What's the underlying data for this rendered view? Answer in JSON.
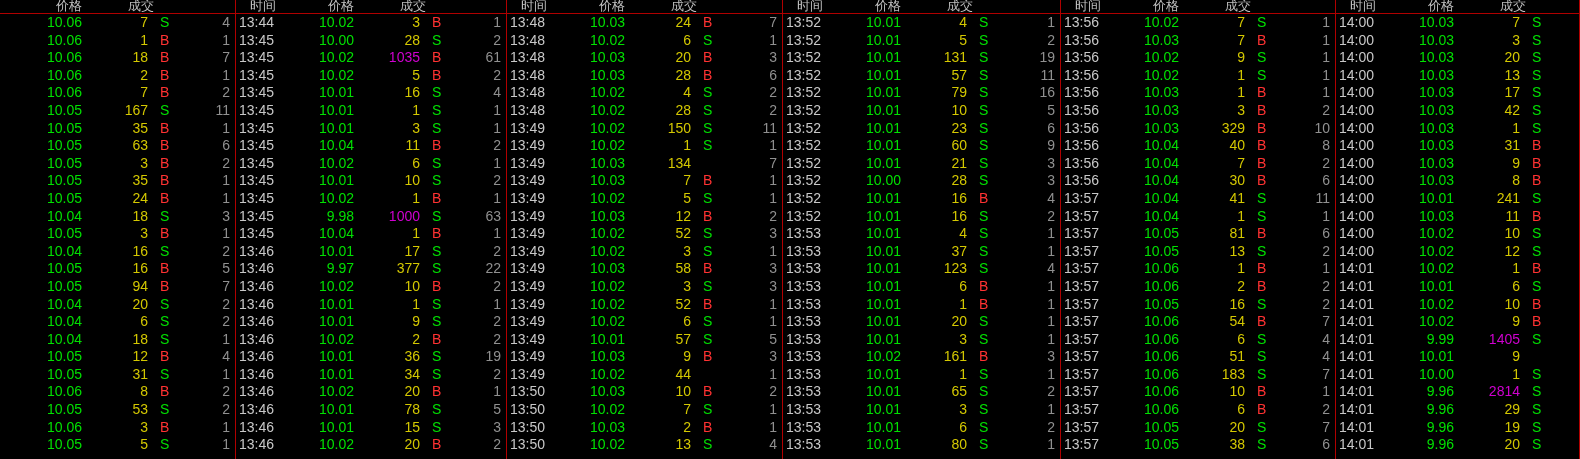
{
  "panels": [
    {
      "headers": [
        "价格",
        "成交"
      ],
      "rows": [
        {
          "price": "10.06",
          "volume": "7",
          "large": false,
          "side": "S",
          "color": "#00e000",
          "count": "4"
        },
        {
          "price": "10.06",
          "volume": "1",
          "large": false,
          "side": "B",
          "color": "#ff3232",
          "count": "1"
        },
        {
          "price": "10.06",
          "volume": "18",
          "large": false,
          "side": "B",
          "color": "#ff3232",
          "count": "7"
        },
        {
          "price": "10.06",
          "volume": "2",
          "large": false,
          "side": "B",
          "color": "#ff3232",
          "count": "1"
        },
        {
          "price": "10.06",
          "volume": "7",
          "large": false,
          "side": "B",
          "color": "#ff3232",
          "count": "2"
        },
        {
          "price": "10.05",
          "volume": "167",
          "large": false,
          "side": "S",
          "color": "#00e000",
          "count": "11"
        },
        {
          "price": "10.05",
          "volume": "35",
          "large": false,
          "side": "B",
          "color": "#ff3232",
          "count": "1"
        },
        {
          "price": "10.05",
          "volume": "63",
          "large": false,
          "side": "B",
          "color": "#ff3232",
          "count": "6"
        },
        {
          "price": "10.05",
          "volume": "3",
          "large": false,
          "side": "B",
          "color": "#ff3232",
          "count": "2"
        },
        {
          "price": "10.05",
          "volume": "35",
          "large": false,
          "side": "B",
          "color": "#ff3232",
          "count": "1"
        },
        {
          "price": "10.05",
          "volume": "24",
          "large": false,
          "side": "B",
          "color": "#ff3232",
          "count": "1"
        },
        {
          "price": "10.04",
          "volume": "18",
          "large": false,
          "side": "S",
          "color": "#00e000",
          "count": "3"
        },
        {
          "price": "10.05",
          "volume": "3",
          "large": false,
          "side": "B",
          "color": "#ff3232",
          "count": "1"
        },
        {
          "price": "10.04",
          "volume": "16",
          "large": false,
          "side": "S",
          "color": "#00e000",
          "count": "2"
        },
        {
          "price": "10.05",
          "volume": "16",
          "large": false,
          "side": "B",
          "color": "#ff3232",
          "count": "5"
        },
        {
          "price": "10.05",
          "volume": "94",
          "large": false,
          "side": "B",
          "color": "#ff3232",
          "count": "7"
        },
        {
          "price": "10.04",
          "volume": "20",
          "large": false,
          "side": "S",
          "color": "#00e000",
          "count": "2"
        },
        {
          "price": "10.04",
          "volume": "6",
          "large": false,
          "side": "S",
          "color": "#00e000",
          "count": "2"
        },
        {
          "price": "10.04",
          "volume": "18",
          "large": false,
          "side": "S",
          "color": "#00e000",
          "count": "1"
        },
        {
          "price": "10.05",
          "volume": "12",
          "large": false,
          "side": "B",
          "color": "#ff3232",
          "count": "4"
        },
        {
          "price": "10.05",
          "volume": "31",
          "large": false,
          "side": "S",
          "color": "#00e000",
          "count": "1"
        },
        {
          "price": "10.06",
          "volume": "8",
          "large": false,
          "side": "B",
          "color": "#ff3232",
          "count": "2"
        },
        {
          "price": "10.05",
          "volume": "53",
          "large": false,
          "side": "S",
          "color": "#00e000",
          "count": "2"
        },
        {
          "price": "10.06",
          "volume": "3",
          "large": false,
          "side": "B",
          "color": "#ff3232",
          "count": "1"
        },
        {
          "price": "10.05",
          "volume": "5",
          "large": false,
          "side": "S",
          "color": "#00e000",
          "count": "1"
        }
      ]
    },
    {
      "headers": [
        "时间",
        "价格",
        "成交"
      ],
      "rows": [
        {
          "time": "13:44",
          "price": "10.02",
          "volume": "3",
          "large": false,
          "side": "B",
          "color": "#ff3232",
          "count": "1"
        },
        {
          "time": "13:45",
          "price": "10.00",
          "volume": "28",
          "large": false,
          "side": "S",
          "color": "#00e000",
          "count": "2"
        },
        {
          "time": "13:45",
          "price": "10.02",
          "volume": "1035",
          "large": true,
          "side": "B",
          "color": "#ff3232",
          "count": "61"
        },
        {
          "time": "13:45",
          "price": "10.02",
          "volume": "5",
          "large": false,
          "side": "B",
          "color": "#ff3232",
          "count": "2"
        },
        {
          "time": "13:45",
          "price": "10.01",
          "volume": "16",
          "large": false,
          "side": "S",
          "color": "#00e000",
          "count": "4"
        },
        {
          "time": "13:45",
          "price": "10.01",
          "volume": "1",
          "large": false,
          "side": "S",
          "color": "#00e000",
          "count": "1"
        },
        {
          "time": "13:45",
          "price": "10.01",
          "volume": "3",
          "large": false,
          "side": "S",
          "color": "#00e000",
          "count": "1"
        },
        {
          "time": "13:45",
          "price": "10.04",
          "volume": "11",
          "large": false,
          "side": "B",
          "color": "#ff3232",
          "count": "2"
        },
        {
          "time": "13:45",
          "price": "10.02",
          "volume": "6",
          "large": false,
          "side": "S",
          "color": "#00e000",
          "count": "1"
        },
        {
          "time": "13:45",
          "price": "10.01",
          "volume": "10",
          "large": false,
          "side": "S",
          "color": "#00e000",
          "count": "2"
        },
        {
          "time": "13:45",
          "price": "10.02",
          "volume": "1",
          "large": false,
          "side": "B",
          "color": "#ff3232",
          "count": "1"
        },
        {
          "time": "13:45",
          "price": "9.98",
          "volume": "1000",
          "large": true,
          "side": "S",
          "color": "#00e000",
          "count": "63"
        },
        {
          "time": "13:45",
          "price": "10.04",
          "volume": "1",
          "large": false,
          "side": "B",
          "color": "#ff3232",
          "count": "1"
        },
        {
          "time": "13:46",
          "price": "10.01",
          "volume": "17",
          "large": false,
          "side": "S",
          "color": "#00e000",
          "count": "2"
        },
        {
          "time": "13:46",
          "price": "9.97",
          "volume": "377",
          "large": false,
          "side": "S",
          "color": "#00e000",
          "count": "22"
        },
        {
          "time": "13:46",
          "price": "10.02",
          "volume": "10",
          "large": false,
          "side": "B",
          "color": "#ff3232",
          "count": "2"
        },
        {
          "time": "13:46",
          "price": "10.01",
          "volume": "1",
          "large": false,
          "side": "S",
          "color": "#00e000",
          "count": "1"
        },
        {
          "time": "13:46",
          "price": "10.01",
          "volume": "9",
          "large": false,
          "side": "S",
          "color": "#00e000",
          "count": "2"
        },
        {
          "time": "13:46",
          "price": "10.02",
          "volume": "2",
          "large": false,
          "side": "B",
          "color": "#ff3232",
          "count": "2"
        },
        {
          "time": "13:46",
          "price": "10.01",
          "volume": "36",
          "large": false,
          "side": "S",
          "color": "#00e000",
          "count": "19"
        },
        {
          "time": "13:46",
          "price": "10.01",
          "volume": "34",
          "large": false,
          "side": "S",
          "color": "#00e000",
          "count": "2"
        },
        {
          "time": "13:46",
          "price": "10.02",
          "volume": "20",
          "large": false,
          "side": "B",
          "color": "#ff3232",
          "count": "1"
        },
        {
          "time": "13:46",
          "price": "10.01",
          "volume": "78",
          "large": false,
          "side": "S",
          "color": "#00e000",
          "count": "5"
        },
        {
          "time": "13:46",
          "price": "10.01",
          "volume": "15",
          "large": false,
          "side": "S",
          "color": "#00e000",
          "count": "3"
        },
        {
          "time": "13:46",
          "price": "10.02",
          "volume": "20",
          "large": false,
          "side": "B",
          "color": "#ff3232",
          "count": "2"
        }
      ]
    },
    {
      "headers": [
        "时间",
        "价格",
        "成交"
      ],
      "rows": [
        {
          "time": "13:48",
          "price": "10.03",
          "volume": "24",
          "large": false,
          "side": "B",
          "color": "#ff3232",
          "count": "7"
        },
        {
          "time": "13:48",
          "price": "10.02",
          "volume": "6",
          "large": false,
          "side": "S",
          "color": "#00e000",
          "count": "1"
        },
        {
          "time": "13:48",
          "price": "10.03",
          "volume": "20",
          "large": false,
          "side": "B",
          "color": "#ff3232",
          "count": "3"
        },
        {
          "time": "13:48",
          "price": "10.03",
          "volume": "28",
          "large": false,
          "side": "B",
          "color": "#ff3232",
          "count": "6"
        },
        {
          "time": "13:48",
          "price": "10.02",
          "volume": "4",
          "large": false,
          "side": "S",
          "color": "#00e000",
          "count": "2"
        },
        {
          "time": "13:48",
          "price": "10.02",
          "volume": "28",
          "large": false,
          "side": "S",
          "color": "#00e000",
          "count": "2"
        },
        {
          "time": "13:49",
          "price": "10.02",
          "volume": "150",
          "large": false,
          "side": "S",
          "color": "#00e000",
          "count": "11"
        },
        {
          "time": "13:49",
          "price": "10.02",
          "volume": "1",
          "large": false,
          "side": "S",
          "color": "#00e000",
          "count": "1"
        },
        {
          "time": "13:49",
          "price": "10.03",
          "volume": "134",
          "large": false,
          "count": "7"
        },
        {
          "time": "13:49",
          "price": "10.03",
          "volume": "7",
          "large": false,
          "side": "B",
          "color": "#ff3232",
          "count": "1"
        },
        {
          "time": "13:49",
          "price": "10.02",
          "volume": "5",
          "large": false,
          "side": "S",
          "color": "#00e000",
          "count": "1"
        },
        {
          "time": "13:49",
          "price": "10.03",
          "volume": "12",
          "large": false,
          "side": "B",
          "color": "#ff3232",
          "count": "2"
        },
        {
          "time": "13:49",
          "price": "10.02",
          "volume": "52",
          "large": false,
          "side": "S",
          "color": "#00e000",
          "count": "3"
        },
        {
          "time": "13:49",
          "price": "10.02",
          "volume": "3",
          "large": false,
          "side": "S",
          "color": "#00e000",
          "count": "1"
        },
        {
          "time": "13:49",
          "price": "10.03",
          "volume": "58",
          "large": false,
          "side": "B",
          "color": "#ff3232",
          "count": "3"
        },
        {
          "time": "13:49",
          "price": "10.02",
          "volume": "3",
          "large": false,
          "side": "S",
          "color": "#00e000",
          "count": "3"
        },
        {
          "time": "13:49",
          "price": "10.02",
          "volume": "52",
          "large": false,
          "side": "B",
          "color": "#ff3232",
          "count": "1"
        },
        {
          "time": "13:49",
          "price": "10.02",
          "volume": "6",
          "large": false,
          "side": "S",
          "color": "#00e000",
          "count": "1"
        },
        {
          "time": "13:49",
          "price": "10.01",
          "volume": "57",
          "large": false,
          "side": "S",
          "color": "#00e000",
          "count": "5"
        },
        {
          "time": "13:49",
          "price": "10.03",
          "volume": "9",
          "large": false,
          "side": "B",
          "color": "#ff3232",
          "count": "3"
        },
        {
          "time": "13:49",
          "price": "10.02",
          "volume": "44",
          "large": false,
          "count": "1"
        },
        {
          "time": "13:50",
          "price": "10.03",
          "volume": "10",
          "large": false,
          "side": "B",
          "color": "#ff3232",
          "count": "2"
        },
        {
          "time": "13:50",
          "price": "10.02",
          "volume": "7",
          "large": false,
          "side": "S",
          "color": "#00e000",
          "count": "1"
        },
        {
          "time": "13:50",
          "price": "10.03",
          "volume": "2",
          "large": false,
          "side": "B",
          "color": "#ff3232",
          "count": "1"
        },
        {
          "time": "13:50",
          "price": "10.02",
          "volume": "13",
          "large": false,
          "side": "S",
          "color": "#00e000",
          "count": "4"
        }
      ]
    },
    {
      "headers": [
        "时间",
        "价格",
        "成交"
      ],
      "rows": [
        {
          "time": "13:52",
          "price": "10.01",
          "volume": "4",
          "large": false,
          "side": "S",
          "color": "#00e000",
          "count": "1"
        },
        {
          "time": "13:52",
          "price": "10.01",
          "volume": "5",
          "large": false,
          "side": "S",
          "color": "#00e000",
          "count": "2"
        },
        {
          "time": "13:52",
          "price": "10.01",
          "volume": "131",
          "large": false,
          "side": "S",
          "color": "#00e000",
          "count": "19"
        },
        {
          "time": "13:52",
          "price": "10.01",
          "volume": "57",
          "large": false,
          "side": "S",
          "color": "#00e000",
          "count": "11"
        },
        {
          "time": "13:52",
          "price": "10.01",
          "volume": "79",
          "large": false,
          "side": "S",
          "color": "#00e000",
          "count": "16"
        },
        {
          "time": "13:52",
          "price": "10.01",
          "volume": "10",
          "large": false,
          "side": "S",
          "color": "#00e000",
          "count": "5"
        },
        {
          "time": "13:52",
          "price": "10.01",
          "volume": "23",
          "large": false,
          "side": "S",
          "color": "#00e000",
          "count": "6"
        },
        {
          "time": "13:52",
          "price": "10.01",
          "volume": "60",
          "large": false,
          "side": "S",
          "color": "#00e000",
          "count": "9"
        },
        {
          "time": "13:52",
          "price": "10.01",
          "volume": "21",
          "large": false,
          "side": "S",
          "color": "#00e000",
          "count": "3"
        },
        {
          "time": "13:52",
          "price": "10.00",
          "volume": "28",
          "large": false,
          "side": "S",
          "color": "#00e000",
          "count": "3"
        },
        {
          "time": "13:52",
          "price": "10.01",
          "volume": "16",
          "large": false,
          "side": "B",
          "color": "#ff3232",
          "count": "4"
        },
        {
          "time": "13:52",
          "price": "10.01",
          "volume": "16",
          "large": false,
          "side": "S",
          "color": "#00e000",
          "count": "2"
        },
        {
          "time": "13:53",
          "price": "10.01",
          "volume": "4",
          "large": false,
          "side": "S",
          "color": "#00e000",
          "count": "1"
        },
        {
          "time": "13:53",
          "price": "10.01",
          "volume": "37",
          "large": false,
          "side": "S",
          "color": "#00e000",
          "count": "1"
        },
        {
          "time": "13:53",
          "price": "10.01",
          "volume": "123",
          "large": false,
          "side": "S",
          "color": "#00e000",
          "count": "4"
        },
        {
          "time": "13:53",
          "price": "10.01",
          "volume": "6",
          "large": false,
          "side": "B",
          "color": "#ff3232",
          "count": "1"
        },
        {
          "time": "13:53",
          "price": "10.01",
          "volume": "1",
          "large": false,
          "side": "B",
          "color": "#ff3232",
          "count": "1"
        },
        {
          "time": "13:53",
          "price": "10.01",
          "volume": "20",
          "large": false,
          "side": "S",
          "color": "#00e000",
          "count": "1"
        },
        {
          "time": "13:53",
          "price": "10.01",
          "volume": "3",
          "large": false,
          "side": "S",
          "color": "#00e000",
          "count": "1"
        },
        {
          "time": "13:53",
          "price": "10.02",
          "volume": "161",
          "large": false,
          "side": "B",
          "color": "#ff3232",
          "count": "3"
        },
        {
          "time": "13:53",
          "price": "10.01",
          "volume": "1",
          "large": false,
          "side": "S",
          "color": "#00e000",
          "count": "1"
        },
        {
          "time": "13:53",
          "price": "10.01",
          "volume": "65",
          "large": false,
          "side": "S",
          "color": "#00e000",
          "count": "2"
        },
        {
          "time": "13:53",
          "price": "10.01",
          "volume": "3",
          "large": false,
          "side": "S",
          "color": "#00e000",
          "count": "1"
        },
        {
          "time": "13:53",
          "price": "10.01",
          "volume": "6",
          "large": false,
          "side": "S",
          "color": "#00e000",
          "count": "2"
        },
        {
          "time": "13:53",
          "price": "10.01",
          "volume": "80",
          "large": false,
          "side": "S",
          "color": "#00e000",
          "count": "1"
        }
      ]
    },
    {
      "headers": [
        "时间",
        "价格",
        "成交"
      ],
      "rows": [
        {
          "time": "13:56",
          "price": "10.02",
          "volume": "7",
          "large": false,
          "side": "S",
          "color": "#00e000",
          "count": "1"
        },
        {
          "time": "13:56",
          "price": "10.03",
          "volume": "7",
          "large": false,
          "side": "B",
          "color": "#ff3232",
          "count": "1"
        },
        {
          "time": "13:56",
          "price": "10.02",
          "volume": "9",
          "large": false,
          "side": "S",
          "color": "#00e000",
          "count": "1"
        },
        {
          "time": "13:56",
          "price": "10.02",
          "volume": "1",
          "large": false,
          "side": "S",
          "color": "#00e000",
          "count": "1"
        },
        {
          "time": "13:56",
          "price": "10.03",
          "volume": "1",
          "large": false,
          "side": "B",
          "color": "#ff3232",
          "count": "1"
        },
        {
          "time": "13:56",
          "price": "10.03",
          "volume": "3",
          "large": false,
          "side": "B",
          "color": "#ff3232",
          "count": "2"
        },
        {
          "time": "13:56",
          "price": "10.03",
          "volume": "329",
          "large": false,
          "side": "B",
          "color": "#ff3232",
          "count": "10"
        },
        {
          "time": "13:56",
          "price": "10.04",
          "volume": "40",
          "large": false,
          "side": "B",
          "color": "#ff3232",
          "count": "8"
        },
        {
          "time": "13:56",
          "price": "10.04",
          "volume": "7",
          "large": false,
          "side": "B",
          "color": "#ff3232",
          "count": "2"
        },
        {
          "time": "13:56",
          "price": "10.04",
          "volume": "30",
          "large": false,
          "side": "B",
          "color": "#ff3232",
          "count": "6"
        },
        {
          "time": "13:57",
          "price": "10.04",
          "volume": "41",
          "large": false,
          "side": "S",
          "color": "#00e000",
          "count": "11"
        },
        {
          "time": "13:57",
          "price": "10.04",
          "volume": "1",
          "large": false,
          "side": "S",
          "color": "#00e000",
          "count": "1"
        },
        {
          "time": "13:57",
          "price": "10.05",
          "volume": "81",
          "large": false,
          "side": "B",
          "color": "#ff3232",
          "count": "6"
        },
        {
          "time": "13:57",
          "price": "10.05",
          "volume": "13",
          "large": false,
          "side": "S",
          "color": "#00e000",
          "count": "2"
        },
        {
          "time": "13:57",
          "price": "10.06",
          "volume": "1",
          "large": false,
          "side": "B",
          "color": "#ff3232",
          "count": "1"
        },
        {
          "time": "13:57",
          "price": "10.06",
          "volume": "2",
          "large": false,
          "side": "B",
          "color": "#ff3232",
          "count": "2"
        },
        {
          "time": "13:57",
          "price": "10.05",
          "volume": "16",
          "large": false,
          "side": "S",
          "color": "#00e000",
          "count": "2"
        },
        {
          "time": "13:57",
          "price": "10.06",
          "volume": "54",
          "large": false,
          "side": "B",
          "color": "#ff3232",
          "count": "7"
        },
        {
          "time": "13:57",
          "price": "10.06",
          "volume": "6",
          "large": false,
          "side": "S",
          "color": "#00e000",
          "count": "4"
        },
        {
          "time": "13:57",
          "price": "10.06",
          "volume": "51",
          "large": false,
          "side": "S",
          "color": "#00e000",
          "count": "4"
        },
        {
          "time": "13:57",
          "price": "10.06",
          "volume": "183",
          "large": false,
          "side": "S",
          "color": "#00e000",
          "count": "7"
        },
        {
          "time": "13:57",
          "price": "10.06",
          "volume": "10",
          "large": false,
          "side": "B",
          "color": "#ff3232",
          "count": "1"
        },
        {
          "time": "13:57",
          "price": "10.06",
          "volume": "6",
          "large": false,
          "side": "B",
          "color": "#ff3232",
          "count": "2"
        },
        {
          "time": "13:57",
          "price": "10.05",
          "volume": "20",
          "large": false,
          "side": "S",
          "color": "#00e000",
          "count": "7"
        },
        {
          "time": "13:57",
          "price": "10.05",
          "volume": "38",
          "large": false,
          "side": "S",
          "color": "#00e000",
          "count": "6"
        }
      ]
    },
    {
      "headers": [
        "时间",
        "价格",
        "成交"
      ],
      "rows": [
        {
          "time": "14:00",
          "price": "10.03",
          "volume": "7",
          "large": false,
          "side": "S",
          "color": "#00e000"
        },
        {
          "time": "14:00",
          "price": "10.03",
          "volume": "3",
          "large": false,
          "side": "S",
          "color": "#00e000"
        },
        {
          "time": "14:00",
          "price": "10.03",
          "volume": "20",
          "large": false,
          "side": "S",
          "color": "#00e000"
        },
        {
          "time": "14:00",
          "price": "10.03",
          "volume": "13",
          "large": false,
          "side": "S",
          "color": "#00e000"
        },
        {
          "time": "14:00",
          "price": "10.03",
          "volume": "17",
          "large": false,
          "side": "S",
          "color": "#00e000"
        },
        {
          "time": "14:00",
          "price": "10.03",
          "volume": "42",
          "large": false,
          "side": "S",
          "color": "#00e000"
        },
        {
          "time": "14:00",
          "price": "10.03",
          "volume": "1",
          "large": false,
          "side": "S",
          "color": "#00e000"
        },
        {
          "time": "14:00",
          "price": "10.03",
          "volume": "31",
          "large": false,
          "side": "B",
          "color": "#ff3232"
        },
        {
          "time": "14:00",
          "price": "10.03",
          "volume": "9",
          "large": false,
          "side": "B",
          "color": "#ff3232"
        },
        {
          "time": "14:00",
          "price": "10.03",
          "volume": "8",
          "large": false,
          "side": "B",
          "color": "#ff3232"
        },
        {
          "time": "14:00",
          "price": "10.01",
          "volume": "241",
          "large": false,
          "side": "S",
          "color": "#00e000"
        },
        {
          "time": "14:00",
          "price": "10.03",
          "volume": "11",
          "large": false,
          "side": "B",
          "color": "#ff3232"
        },
        {
          "time": "14:00",
          "price": "10.02",
          "volume": "10",
          "large": false,
          "side": "S",
          "color": "#00e000"
        },
        {
          "time": "14:00",
          "price": "10.02",
          "volume": "12",
          "large": false,
          "side": "S",
          "color": "#00e000"
        },
        {
          "time": "14:01",
          "price": "10.02",
          "volume": "1",
          "large": false,
          "side": "B",
          "color": "#ff3232"
        },
        {
          "time": "14:01",
          "price": "10.01",
          "volume": "6",
          "large": false,
          "side": "S",
          "color": "#00e000"
        },
        {
          "time": "14:01",
          "price": "10.02",
          "volume": "10",
          "large": false,
          "side": "B",
          "color": "#ff3232"
        },
        {
          "time": "14:01",
          "price": "10.02",
          "volume": "9",
          "large": false,
          "side": "B",
          "color": "#ff3232"
        },
        {
          "time": "14:01",
          "price": "9.99",
          "volume": "1405",
          "large": true,
          "side": "S",
          "color": "#00e000"
        },
        {
          "time": "14:01",
          "price": "10.01",
          "volume": "9",
          "large": false
        },
        {
          "time": "14:01",
          "price": "10.00",
          "volume": "1",
          "large": false,
          "side": "S",
          "color": "#00e000"
        },
        {
          "time": "14:01",
          "price": "9.96",
          "volume": "2814",
          "large": true,
          "side": "S",
          "color": "#00e000"
        },
        {
          "time": "14:01",
          "price": "9.96",
          "volume": "29",
          "large": false,
          "side": "S",
          "color": "#00e000"
        },
        {
          "time": "14:01",
          "price": "9.96",
          "volume": "19",
          "large": false,
          "side": "S",
          "color": "#00e000"
        },
        {
          "time": "14:01",
          "price": "9.96",
          "volume": "20",
          "large": false,
          "side": "S",
          "color": "#00e000"
        }
      ]
    }
  ]
}
